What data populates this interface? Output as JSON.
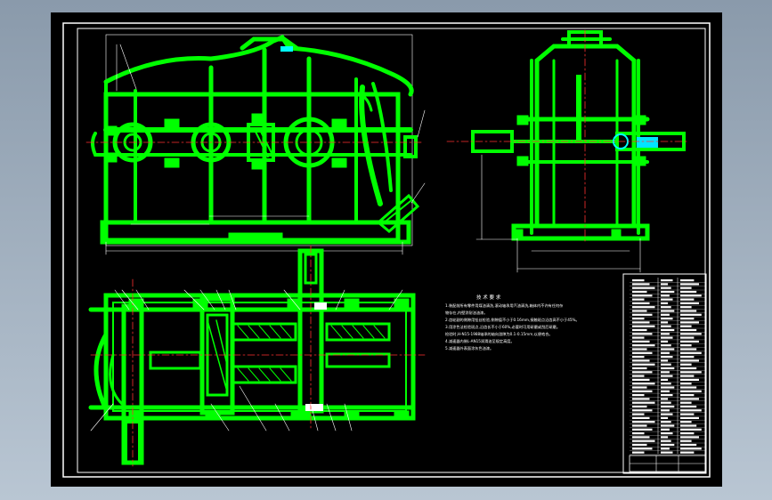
{
  "drawing": {
    "background": "#000000",
    "frame_color": "#ffffff",
    "line_color": "#00ff00",
    "center_color": "#ff3030",
    "dim_color": "#ffffff",
    "accent_color": "#00e5ff"
  },
  "notes": {
    "title": "技 术 要 求",
    "lines": [
      "1.装配前所有零件用煤油清洗,滚动轴承用汽油清洗,箱体内不许有任何杂",
      "  物存在,内壁涂耐油油漆。",
      "2.齿轮副的侧隙用铅丝检验,侧隙值不小于0.16mm,接触斑点沿齿高不小于45%。",
      "3.用涂色法检验斑点,沿齿长不小于60%,必要时可用研磨或刮后研磨。",
      "  检验时,H-N15-1988轴承的轴向游隙为0.1-0.15mm,以便啮合。",
      "4.减速器内装L-AN15润滑油至规定高度。",
      "5.减速器外表面涂灰色油漆。"
    ]
  }
}
